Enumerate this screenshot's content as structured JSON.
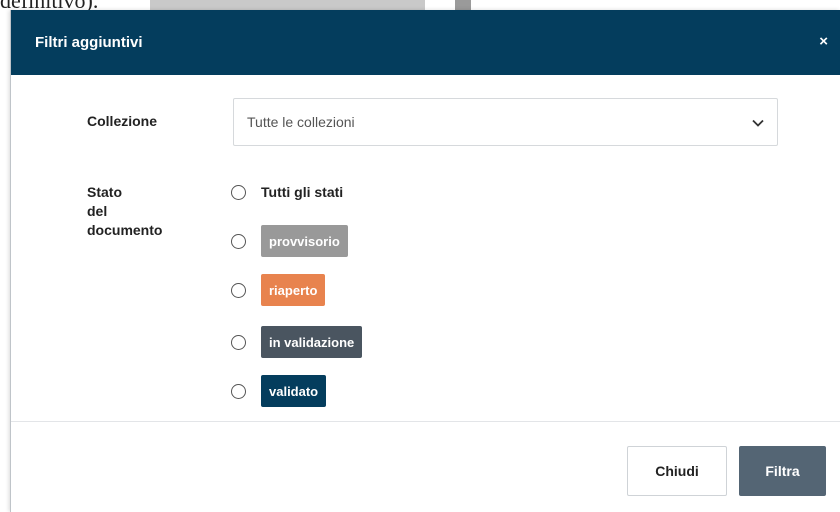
{
  "background": {
    "text_fragment": "definitivo)."
  },
  "modal": {
    "title": "Filtri aggiuntivi",
    "close_label": "×"
  },
  "collection": {
    "label": "Collezione",
    "selected": "Tutte le collezioni"
  },
  "status": {
    "label_line1": "Stato",
    "label_line2": "del",
    "label_line3": "documento",
    "options": [
      {
        "label": "Tutti gli stati"
      },
      {
        "label": "provvisorio",
        "color": "#999999"
      },
      {
        "label": "riaperto",
        "color": "#e8834e"
      },
      {
        "label": "in validazione",
        "color": "#4a5560"
      },
      {
        "label": "validato",
        "color": "#043d5d"
      }
    ]
  },
  "footer": {
    "close_button": "Chiudi",
    "filter_button": "Filtra"
  },
  "colors": {
    "header_bg": "#043d5d",
    "primary_button": "#546574"
  }
}
